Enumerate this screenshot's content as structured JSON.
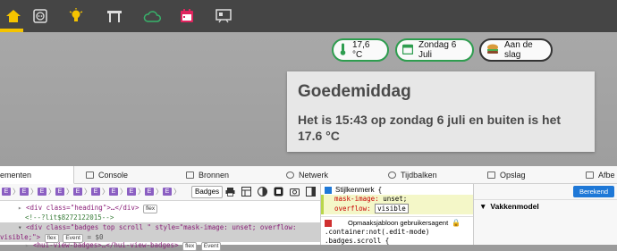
{
  "nav": {
    "items": [
      {
        "name": "home-icon"
      },
      {
        "name": "power-socket-icon"
      },
      {
        "name": "lightbulb-icon"
      },
      {
        "name": "table-icon"
      },
      {
        "name": "cloud-icon"
      },
      {
        "name": "calendar-icon"
      },
      {
        "name": "presentation-icon"
      }
    ]
  },
  "badges": {
    "temperature": "17,6 °C",
    "date": "Zondag 6 Juli",
    "action": "Aan de slag"
  },
  "greeting": {
    "title": "Goedemiddag",
    "text": "Het is 15:43 op zondag 6 juli en buiten is het 17.6 °C"
  },
  "devtools": {
    "tabs": [
      "ementen",
      "Console",
      "Bronnen",
      "Netwerk",
      "Tijdbalken",
      "Opslag",
      "Afbe"
    ],
    "crumb_label": "E",
    "badges_chip": "Badges",
    "dom": {
      "line1_tag": "<div class=\"heading\">…</div>",
      "line1_pill": "flex",
      "line2": "<!--?lit$8272122015-->",
      "line3a": "<div class=\"badges top scroll \" style=\"mask-image: unset; overflow:",
      "line3b": "visible;\">",
      "line3_pill1": "flex",
      "line3_pill2": "Event",
      "line3_ref": "= $0",
      "line4": "<hui-view-badges>…</hui-view-badges>",
      "line4_pill1": "flex",
      "line4_pill2": "Event"
    },
    "styles": {
      "header": "Stijlkenmerk",
      "brace": "{",
      "prop1": "mask-image:",
      "val1": "unset;",
      "prop2": "overflow:",
      "val2": "visible",
      "ua_label": "Opmaaksjabloon gebruikersagent",
      "rule1": ".container:not(.edit-mode)",
      "rule2": ".badges.scroll {"
    },
    "computed": {
      "button": "Berekend",
      "section": "Vakkenmodel"
    }
  },
  "colors": {
    "accent": "#f5c400",
    "badge_border": "#2e9d4f",
    "topbar": "#454545"
  }
}
